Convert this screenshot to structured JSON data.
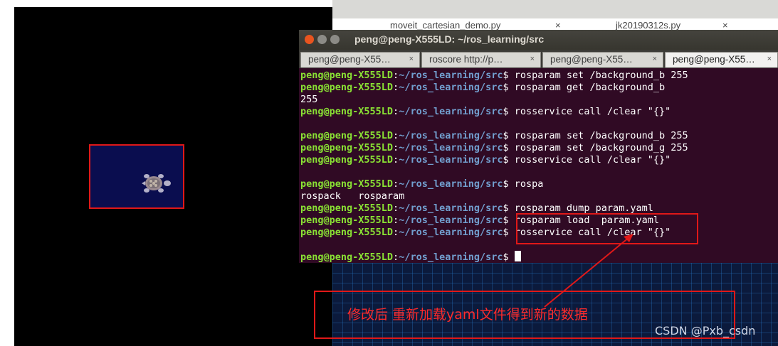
{
  "editor_tabs": [
    "moveit_cartesian_demo.py",
    "jk20190312s.py"
  ],
  "window": {
    "title": "peng@peng-X555LD: ~/ros_learning/src"
  },
  "terminal_tabs": [
    {
      "label": "peng@peng-X55…",
      "close": "×"
    },
    {
      "label": "roscore http://p…",
      "close": "×"
    },
    {
      "label": "peng@peng-X55…",
      "close": "×"
    },
    {
      "label": "peng@peng-X55…",
      "close": "×"
    }
  ],
  "prompt": {
    "user": "peng@peng-X555LD",
    "sep": ":",
    "path": "~/ros_learning/src",
    "sign": "$"
  },
  "lines": [
    {
      "cmd": "rosparam set /background_b 255"
    },
    {
      "cmd": "rosparam get /background_b"
    },
    {
      "out": "255"
    },
    {
      "cmd": "rosservice call /clear \"{}\""
    },
    {
      "blank": true
    },
    {
      "cmd": "rosparam set /background_b 255"
    },
    {
      "cmd": "rosparam set /background_g 255"
    },
    {
      "cmd": "rosservice call /clear \"{}\""
    },
    {
      "blank": true
    },
    {
      "cmd": "rospa"
    },
    {
      "out": "rospack   rosparam"
    },
    {
      "cmd": "rosparam dump param.yaml"
    },
    {
      "cmd": "rosparam load  param.yaml"
    },
    {
      "cmd": "rosservice call /clear \"{}\""
    },
    {
      "blank": true
    },
    {
      "cmd": "",
      "cursor": true
    }
  ],
  "annotation": "修改后 重新加载yaml文件得到新的数据",
  "watermark": "CSDN @Pxb_csdn",
  "colors": {
    "terminal_bg": "#300a24",
    "prompt_user": "#8ae234",
    "prompt_path": "#729fcf",
    "highlight": "#e01818",
    "turtle_bg": "#0a0d4f"
  }
}
